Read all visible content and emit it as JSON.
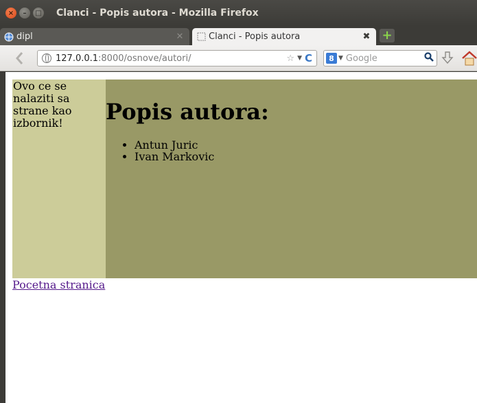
{
  "window": {
    "title": "Clanci - Popis autora - Mozilla Firefox"
  },
  "tabs": [
    {
      "label": "dipl",
      "active": false
    },
    {
      "label": "Clanci - Popis autora",
      "active": true
    }
  ],
  "urlbar": {
    "host": "127.0.0.1",
    "path": ":8000/osnove/autori/"
  },
  "search": {
    "placeholder": "Google",
    "engine_letter": "8"
  },
  "sidebar": {
    "text": "Ovo ce se nalaziti sa strane kao izbornik!"
  },
  "main": {
    "heading": "Popis autora:",
    "authors": [
      "Antun Juric",
      "Ivan Markovic"
    ]
  },
  "footer": {
    "home_link": "Pocetna stranica"
  },
  "colors": {
    "sidebar_bg": "#cccc99",
    "main_bg": "#999966",
    "link": "#551a8b"
  },
  "icons": [
    "close-icon",
    "minimize-icon",
    "maximize-icon",
    "globe-icon",
    "star-icon",
    "reload-icon",
    "search-icon",
    "download-icon",
    "home-icon",
    "back-icon",
    "plus-icon"
  ]
}
